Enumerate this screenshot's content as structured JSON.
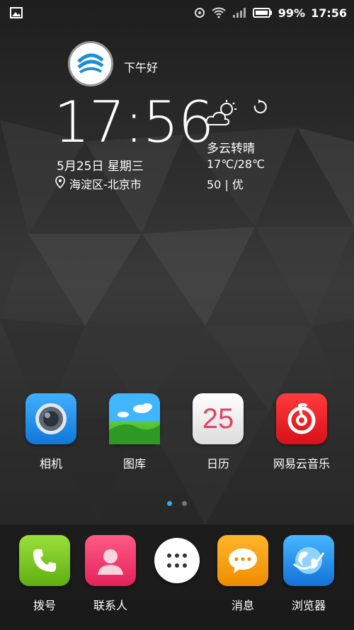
{
  "status_bar": {
    "battery": "99%",
    "time": "17:56",
    "icons": [
      "picture-notification-icon",
      "bluetooth-settings-icon",
      "wifi-icon",
      "signal-icon",
      "battery-icon"
    ]
  },
  "widget": {
    "greeting": "下午好",
    "time": "17:56",
    "date": "5月25日 星期三",
    "location": "海淀区-北京市",
    "weather": "多云转晴",
    "temperature": "17℃/28℃",
    "aqi": "50 | 优"
  },
  "apps": [
    {
      "label": "相机",
      "icon": "camera-icon",
      "color": "#1e90f0"
    },
    {
      "label": "图库",
      "icon": "gallery-icon",
      "color": "#2aa3f3"
    },
    {
      "label": "日历",
      "icon": "calendar-icon",
      "color": "#f2f2f2",
      "day": "25"
    },
    {
      "label": "网易云音乐",
      "icon": "netease-music-icon",
      "color": "#e3161f"
    }
  ],
  "pager": {
    "pages": 2,
    "current": 1
  },
  "dock": [
    {
      "label": "拨号",
      "icon": "phone-icon",
      "color": "#7cc520"
    },
    {
      "label": "联系人",
      "icon": "contacts-icon",
      "color": "#f2386a"
    },
    {
      "label": "",
      "icon": "app-drawer-icon",
      "color": "#ffffff"
    },
    {
      "label": "消息",
      "icon": "messages-icon",
      "color": "#f59b0d"
    },
    {
      "label": "浏览器",
      "icon": "browser-icon",
      "color": "#1a8ff0"
    }
  ]
}
